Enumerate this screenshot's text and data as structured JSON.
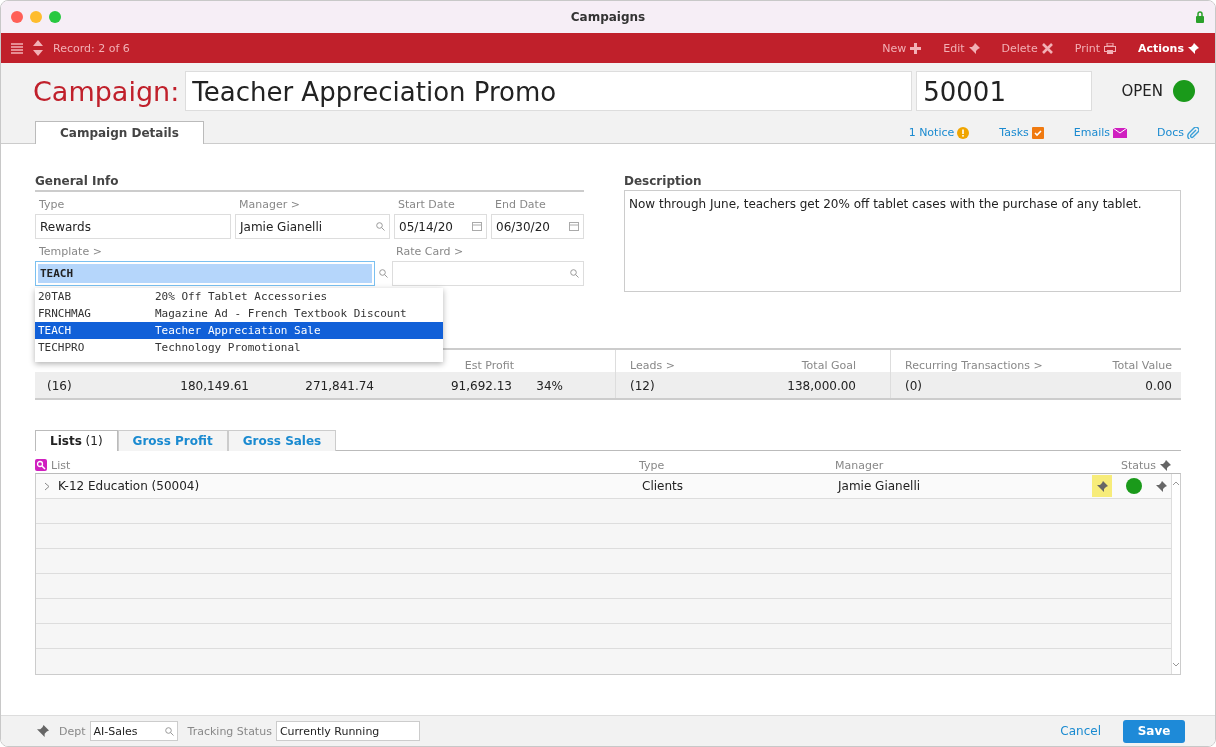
{
  "window": {
    "title": "Campaigns"
  },
  "toolbar": {
    "record": "Record: 2 of 6",
    "actions": [
      {
        "label": "New",
        "kind": "new"
      },
      {
        "label": "Edit",
        "kind": "pin"
      },
      {
        "label": "Delete",
        "kind": "delete"
      },
      {
        "label": "Print",
        "kind": "print"
      },
      {
        "label": "Actions",
        "kind": "actions"
      }
    ]
  },
  "header": {
    "label": "Campaign:",
    "name": "Teacher Appreciation Promo",
    "number": "50001",
    "status": {
      "label": "OPEN",
      "color": "#1a9a1a"
    }
  },
  "main_tab": {
    "label": "Campaign Details",
    "selected": true
  },
  "links": [
    {
      "label": "1 Notice",
      "kind": "notice"
    },
    {
      "label": "Tasks",
      "kind": "tasks"
    },
    {
      "label": "Emails",
      "kind": "emails"
    },
    {
      "label": "Docs",
      "kind": "docs"
    }
  ],
  "general_info": {
    "title": "General Info",
    "type": {
      "label": "Type",
      "value": "Rewards"
    },
    "manager": {
      "label": "Manager >",
      "value": "Jamie Gianelli"
    },
    "start_date": {
      "label": "Start Date",
      "value": "05/14/20"
    },
    "end_date": {
      "label": "End Date",
      "value": "06/30/20"
    },
    "template": {
      "label": "Template >",
      "value": "TEACH"
    },
    "rate_card": {
      "label": "Rate Card >"
    }
  },
  "template_dropdown": [
    {
      "code": "20TAB",
      "name": "20% Off Tablet Accessories",
      "selected": false
    },
    {
      "code": "FRNCHMAG",
      "name": "Magazine Ad - French Textbook Discount",
      "selected": false
    },
    {
      "code": "TEACH",
      "name": "Teacher Appreciation Sale",
      "selected": true
    },
    {
      "code": "TECHPRO",
      "name": "Technology Promotional",
      "selected": false
    }
  ],
  "description": {
    "title": "Description",
    "value": "Now through June, teachers get 20% off tablet cases with the purchase of any tablet."
  },
  "stats": [
    {
      "value": "(16)"
    },
    {
      "value": "180,149.61"
    },
    {
      "value": "271,841.74"
    },
    {
      "label": "Est Profit",
      "value": "91,692.13"
    },
    {
      "value": "34%"
    },
    {
      "label": "Leads >",
      "value": "(12)"
    },
    {
      "label": "Total Goal",
      "value": "138,000.00"
    },
    {
      "label": "Recurring Transactions >",
      "value": "(0)"
    },
    {
      "label": "Total Value",
      "value": "0.00"
    }
  ],
  "sub_tabs": [
    {
      "label": "**Lists** (1)",
      "selected": true
    },
    {
      "label": "Gross Profit",
      "selected": false
    },
    {
      "label": "Gross Sales",
      "selected": false
    }
  ],
  "lists_table": {
    "columns": [
      "List",
      "Type",
      "Manager",
      "Status"
    ],
    "rows": [
      {
        "list": "K-12 Education  (50004)",
        "type": "Clients",
        "manager": "Jamie Gianelli",
        "color": "#1a9a1a"
      }
    ]
  },
  "footer": {
    "dept_label": "Dept",
    "dept": "AI-Sales",
    "tracking_label": "Tracking Status",
    "tracking": "Currently Running",
    "cancel": "Cancel",
    "save": "Save"
  }
}
